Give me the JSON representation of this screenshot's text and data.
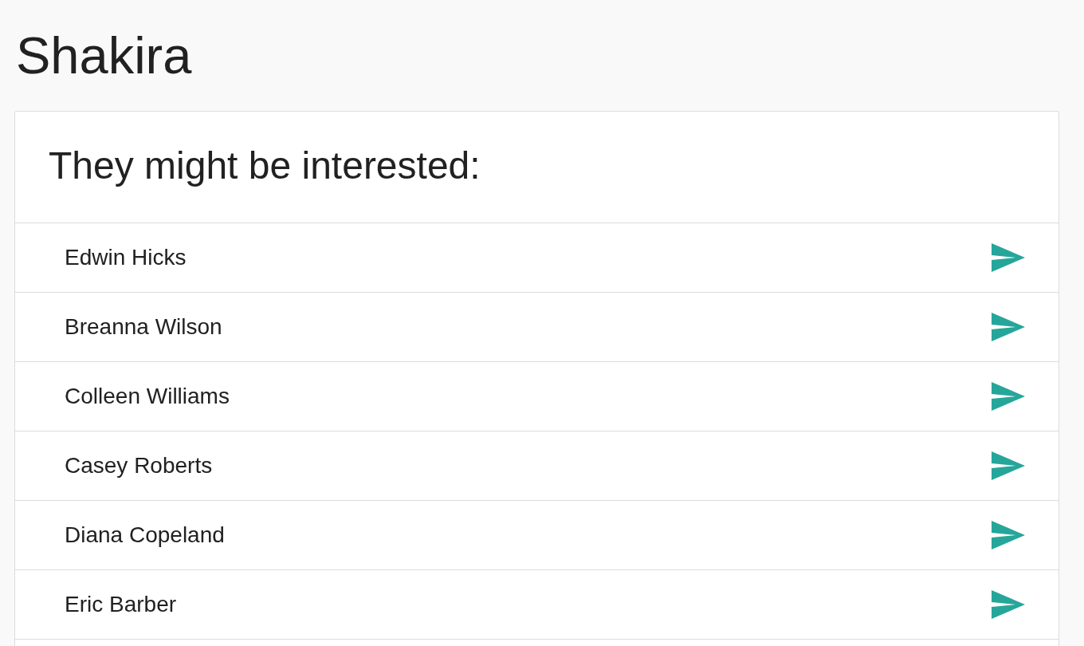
{
  "page": {
    "title": "Shakira"
  },
  "card": {
    "title": "They might be interested:",
    "people": [
      {
        "name": "Edwin Hicks"
      },
      {
        "name": "Breanna Wilson"
      },
      {
        "name": "Colleen Williams"
      },
      {
        "name": "Casey Roberts"
      },
      {
        "name": "Diana Copeland"
      },
      {
        "name": "Eric Barber"
      }
    ]
  }
}
